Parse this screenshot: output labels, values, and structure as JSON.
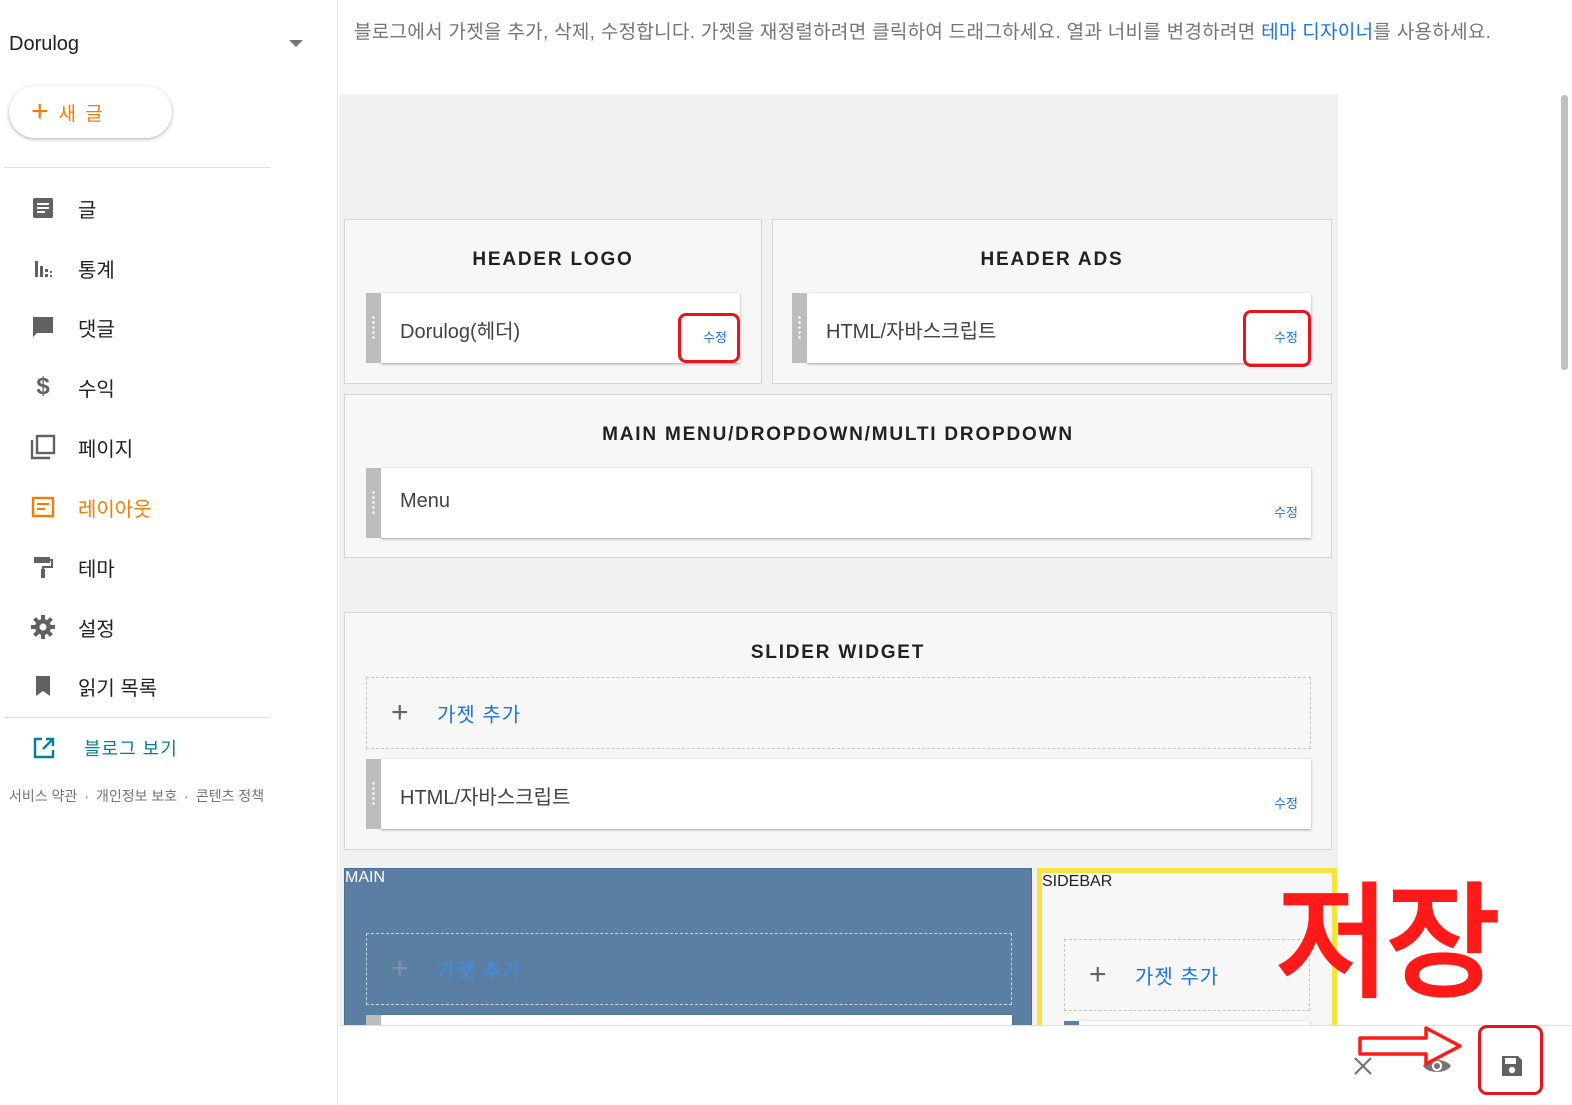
{
  "sidebar": {
    "blog_name": "Dorulog",
    "new_post_label": "새 글",
    "nav": [
      {
        "label": "글",
        "icon": "posts-icon"
      },
      {
        "label": "통계",
        "icon": "stats-icon"
      },
      {
        "label": "댓글",
        "icon": "comments-icon"
      },
      {
        "label": "수익",
        "icon": "earnings-icon"
      },
      {
        "label": "페이지",
        "icon": "pages-icon"
      },
      {
        "label": "레이아웃",
        "icon": "layout-icon",
        "active": true
      },
      {
        "label": "테마",
        "icon": "theme-icon"
      },
      {
        "label": "설정",
        "icon": "settings-icon"
      },
      {
        "label": "읽기 목록",
        "icon": "reading-list-icon"
      }
    ],
    "view_blog_label": "블로그 보기",
    "footer": {
      "terms": "서비스 약관",
      "privacy": "개인정보 보호",
      "content_policy": "콘텐츠 정책",
      "separator": "·"
    }
  },
  "description": {
    "text_before": "블로그에서 가젯을 추가, 삭제, 수정합니다. 가젯을 재정렬하려면 클릭하여 드래그하세요. 열과 너비를 변경하려면 ",
    "link": "테마 디자이너",
    "text_after": "를 사용하세요."
  },
  "layout": {
    "header_logo": {
      "title": "HEADER LOGO",
      "gadget": "Dorulog(헤더)",
      "edit": "수정"
    },
    "header_ads": {
      "title": "HEADER ADS",
      "gadget": "HTML/자바스크립트",
      "edit": "수정"
    },
    "main_menu": {
      "title": "MAIN MENU/DROPDOWN/MULTI DROPDOWN",
      "gadget": "Menu",
      "edit": "수정"
    },
    "slider": {
      "title": "SLIDER WIDGET",
      "add": "가젯 추가",
      "gadget": "HTML/자바스크립트",
      "edit": "수정"
    },
    "main": {
      "title": "MAIN",
      "add": "가젯 추가"
    },
    "sidebar": {
      "title": "SIDEBAR",
      "add": "가젯 추가"
    }
  },
  "annotation": {
    "text": "저장"
  },
  "colors": {
    "accent": "#f57c00",
    "link": "#1a73e8",
    "main_section": "#5b7fa3",
    "highlight": "#f6e43e",
    "annotation_red": "#e8141d"
  }
}
